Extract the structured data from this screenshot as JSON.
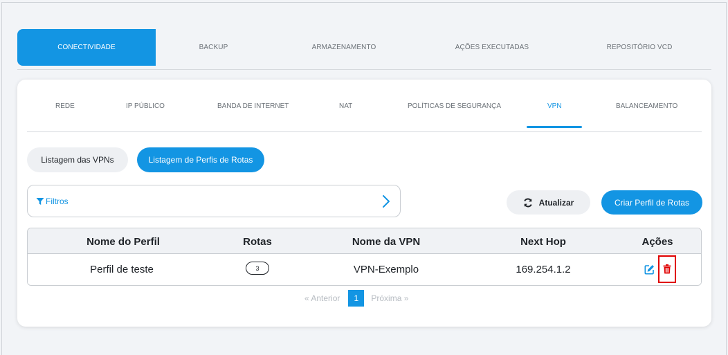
{
  "top_tabs": [
    {
      "label": "CONECTIVIDADE",
      "active": true
    },
    {
      "label": "BACKUP",
      "active": false
    },
    {
      "label": "ARMAZENAMENTO",
      "active": false
    },
    {
      "label": "AÇÕES EXECUTADAS",
      "active": false
    },
    {
      "label": "REPOSITÓRIO VCD",
      "active": false
    }
  ],
  "sub_tabs": [
    {
      "label": "REDE",
      "active": false
    },
    {
      "label": "IP PÚBLICO",
      "active": false
    },
    {
      "label": "BANDA DE INTERNET",
      "active": false
    },
    {
      "label": "NAT",
      "active": false
    },
    {
      "label": "POLÍTICAS DE SEGURANÇA",
      "active": false
    },
    {
      "label": "VPN",
      "active": true
    },
    {
      "label": "BALANCEAMENTO",
      "active": false
    }
  ],
  "list_buttons": {
    "vpn_list": "Listagem das VPNs",
    "route_profiles_list": "Listagem de Perfis de Rotas"
  },
  "filters": {
    "label": "Filtros"
  },
  "actions": {
    "refresh": "Atualizar",
    "create": "Criar Perfil de Rotas"
  },
  "table": {
    "headers": [
      "Nome do Perfil",
      "Rotas",
      "Nome da VPN",
      "Next Hop",
      "Ações"
    ],
    "rows": [
      {
        "profile_name": "Perfil de teste",
        "routes": "3",
        "vpn_name": "VPN-Exemplo",
        "next_hop": "169.254.1.2"
      }
    ]
  },
  "pagination": {
    "prev": "«  Anterior",
    "current": "1",
    "next": "Próxima  »"
  },
  "colors": {
    "accent": "#1395e3",
    "danger": "#e00000"
  }
}
